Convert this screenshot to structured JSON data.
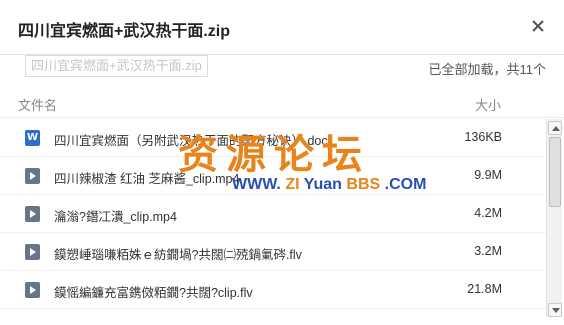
{
  "window": {
    "title": "四川宜宾燃面+武汉热干面.zip",
    "close_icon": "close-icon"
  },
  "breadcrumb": {
    "current": "四川宜宾燃面+武汉热干面.zip"
  },
  "status": "已全部加载，共11个",
  "columns": {
    "name": "文件名",
    "size": "大小"
  },
  "files": [
    {
      "icon": "word-doc-icon",
      "name": "四川宜宾燃面（另附武汉热干面的配方秘诀）.doc",
      "size": "136KB"
    },
    {
      "icon": "video-file-icon",
      "name": "四川辣椒渣 红油 芝麻酱_clip.mp4",
      "size": "9.9M"
    },
    {
      "icon": "video-file-icon",
      "name": "瀹滃?鐕冮潰_clip.mp4",
      "size": "4.2M"
    },
    {
      "icon": "video-file-icon",
      "name": "鏌愬崜瑙嗛粨姝ｅ紡鐗堝?共闊㈡殑鍋氭硶.flv",
      "size": "3.2M"
    },
    {
      "icon": "video-file-icon",
      "name": "鏌愮編鐮充富鎸傚粨鐗?共闊?clip.flv",
      "size": "21.8M"
    }
  ],
  "watermark": {
    "cn": "资源论坛",
    "en_prefix": "WWW.",
    "en_zi": "ZI",
    "en_yuan": "Yuan",
    "en_bbs": "BBS",
    "en_suffix": ".COM",
    "color_cn": "#e8841a",
    "color_blue": "#2a4fb0"
  }
}
